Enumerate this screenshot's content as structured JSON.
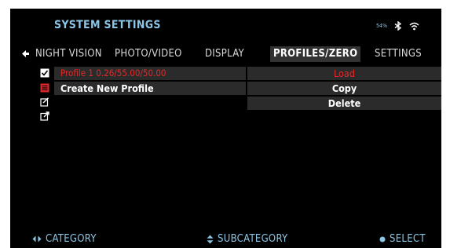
{
  "header": {
    "title": "SYSTEM SETTINGS",
    "battery": "54%",
    "icons": [
      "bluetooth-icon",
      "wifi-icon"
    ]
  },
  "tabs": [
    {
      "label": "NIGHT VISION",
      "active": false
    },
    {
      "label": "PHOTO/VIDEO",
      "active": false
    },
    {
      "label": "DISPLAY",
      "active": false
    },
    {
      "label": "PROFILES/ZERO",
      "active": true
    },
    {
      "label": "SETTINGS",
      "active": false
    }
  ],
  "profiles": {
    "rows": [
      {
        "name": "Profile 1 0.26/55.00/50.00",
        "icon": "checkbox-checked-icon",
        "highlighted": true
      },
      {
        "name": "Create New Profile",
        "icon": "create-profile-icon",
        "highlighted": false
      },
      {
        "name": "",
        "icon": "edit-icon",
        "highlighted": false
      },
      {
        "name": "",
        "icon": "export-icon",
        "highlighted": false
      }
    ],
    "options": [
      {
        "label": "Load",
        "selected": true
      },
      {
        "label": "Copy",
        "selected": false
      },
      {
        "label": "Delete",
        "selected": false
      }
    ]
  },
  "footer": {
    "category": "CATEGORY",
    "subcategory": "SUBCATEGORY",
    "select": "SELECT"
  },
  "colors": {
    "accent": "#8cc6e6",
    "selected": "#e02a2a",
    "row_bg": "#2b2b2b",
    "background": "#000000"
  }
}
